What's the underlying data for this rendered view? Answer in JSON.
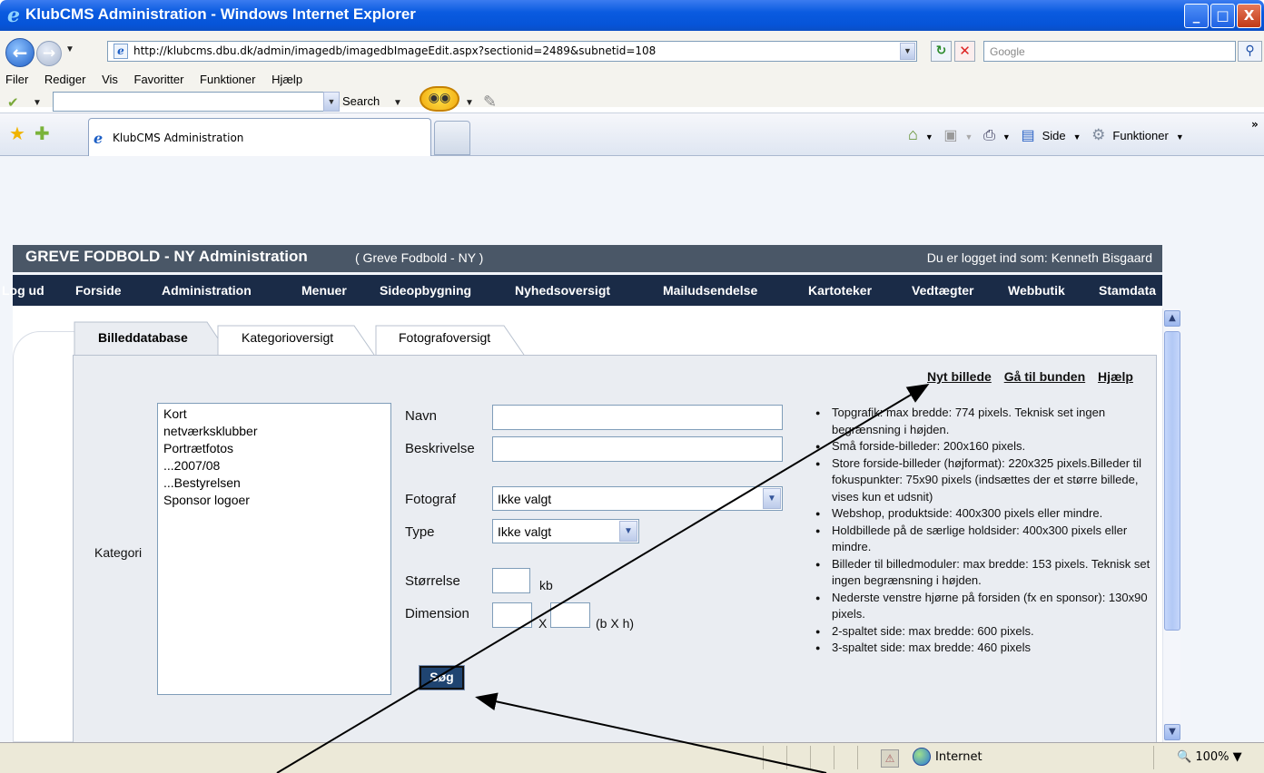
{
  "window": {
    "title": "KlubCMS Administration - Windows Internet Explorer",
    "btn_min": "_",
    "btn_max": "□",
    "btn_close": "X"
  },
  "browser": {
    "url": "http://klubcms.dbu.dk/admin/imagedb/imagedbImageEdit.aspx?sectionid=2489&subnetid=108",
    "search_placeholder": "Google",
    "menu": [
      "Filer",
      "Rediger",
      "Vis",
      "Favoritter",
      "Funktioner",
      "Hjælp"
    ],
    "toolbar_search": "Search",
    "tab_label": "KlubCMS Administration",
    "cmd_side": "Side",
    "cmd_funktioner": "Funktioner"
  },
  "site": {
    "header_title": "GREVE FODBOLD - NY Administration",
    "header_sub": "( Greve Fodbold - NY )",
    "logged_in": "Du er logget ind som: Kenneth Bisgaard",
    "nav": [
      "Log ud",
      "Forside",
      "Administration",
      "Menuer",
      "Sideopbygning",
      "Nyhedsoversigt",
      "Mailudsendelse",
      "Kartoteker",
      "Vedtægter",
      "Webbutik",
      "Stamdata"
    ]
  },
  "tabs": [
    "Billeddatabase",
    "Kategorioversigt",
    "Fotografoversigt"
  ],
  "links": [
    "Nyt billede",
    "Gå til bunden",
    "Hjælp"
  ],
  "form": {
    "kategori_label": "Kategori",
    "kategori_options": [
      "Kort",
      "netværksklubber",
      "Portrætfotos",
      "...2007/08",
      "...Bestyrelsen",
      "Sponsor logoer"
    ],
    "navn_label": "Navn",
    "beskrivelse_label": "Beskrivelse",
    "fotograf_label": "Fotograf",
    "fotograf_value": "Ikke valgt",
    "type_label": "Type",
    "type_value": "Ikke valgt",
    "storrelse_label": "Størrelse",
    "storrelse_unit": "kb",
    "dimension_label": "Dimension",
    "dimension_x": "X",
    "dimension_unit": "(b X h)",
    "sog_button": "Søg"
  },
  "info": [
    "Topgrafik: max bredde: 774 pixels. Teknisk set ingen begrænsning i højden.",
    "Små forside-billeder: 200x160 pixels.",
    "Store forside-billeder (højformat): 220x325 pixels.Billeder til fokuspunkter: 75x90 pixels (indsættes der et større billede, vises kun et udsnit)",
    "Webshop, produktside: 400x300 pixels eller mindre.",
    "Holdbillede på de særlige holdsider: 400x300 pixels eller mindre.",
    "Billeder til billedmoduler: max bredde: 153 pixels. Teknisk set ingen begrænsning i højden.",
    "Nederste venstre hjørne på forsiden (fx en sponsor): 130x90 pixels.",
    "2-spaltet side: max bredde: 600 pixels.",
    "3-spaltet side: max bredde: 460 pixels"
  ],
  "status": {
    "zone": "Internet",
    "zoom": "100%"
  }
}
